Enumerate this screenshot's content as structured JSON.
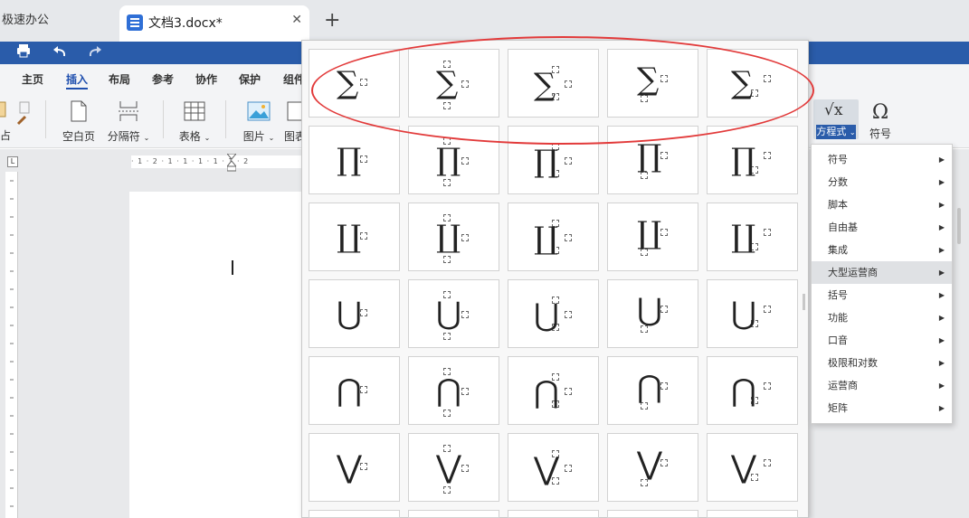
{
  "tabs": {
    "app_label": "极速办公",
    "doc_title": "文档3.docx*",
    "close_glyph": "✕",
    "add_glyph": "+"
  },
  "quickbar": {
    "print_icon": "printer-icon",
    "undo_icon": "undo-icon",
    "redo_icon": "redo-icon"
  },
  "menu": [
    "主页",
    "插入",
    "布局",
    "参考",
    "协作",
    "保护",
    "组件"
  ],
  "ribbon": {
    "blank_page": "空白页",
    "separator": "分隔符",
    "table": "表格",
    "picture": "图片",
    "chart": "图表",
    "equation": "方程式",
    "symbol": "符号",
    "equation_glyph": "√x",
    "symbol_glyph": "Ω",
    "paste_fragment": "占"
  },
  "ruler": {
    "horizontal_ticks": "· 1 · 2 · 1 · 1 · 1 · 1 · 1 · 2"
  },
  "gallery": {
    "operators": [
      "∑",
      "∏",
      "∐",
      "⋃",
      "⋂",
      "⋁"
    ]
  },
  "equation_menu": {
    "items": [
      "符号",
      "分数",
      "脚本",
      "自由基",
      "集成",
      "大型运营商",
      "括号",
      "功能",
      "口音",
      "极限和对数",
      "运营商",
      "矩阵"
    ],
    "highlighted_index": 5
  }
}
